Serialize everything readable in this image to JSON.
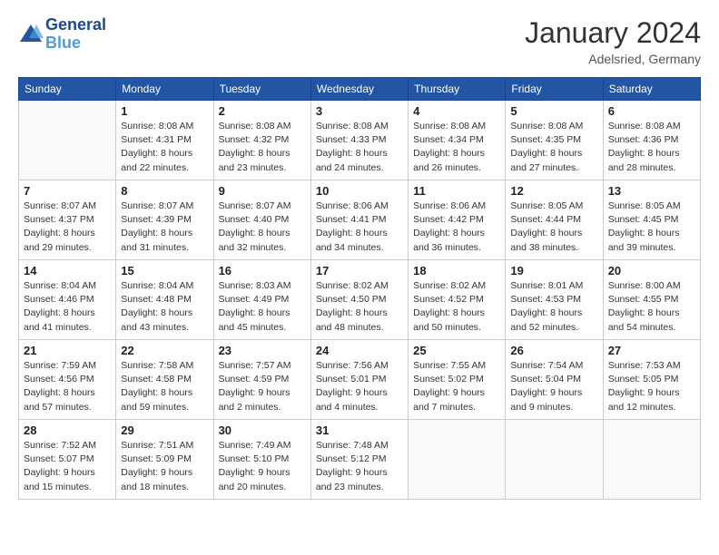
{
  "header": {
    "logo_line1": "General",
    "logo_line2": "Blue",
    "month": "January 2024",
    "location": "Adelsried, Germany"
  },
  "days_of_week": [
    "Sunday",
    "Monday",
    "Tuesday",
    "Wednesday",
    "Thursday",
    "Friday",
    "Saturday"
  ],
  "weeks": [
    [
      {
        "day": "",
        "info": ""
      },
      {
        "day": "1",
        "info": "Sunrise: 8:08 AM\nSunset: 4:31 PM\nDaylight: 8 hours\nand 22 minutes."
      },
      {
        "day": "2",
        "info": "Sunrise: 8:08 AM\nSunset: 4:32 PM\nDaylight: 8 hours\nand 23 minutes."
      },
      {
        "day": "3",
        "info": "Sunrise: 8:08 AM\nSunset: 4:33 PM\nDaylight: 8 hours\nand 24 minutes."
      },
      {
        "day": "4",
        "info": "Sunrise: 8:08 AM\nSunset: 4:34 PM\nDaylight: 8 hours\nand 26 minutes."
      },
      {
        "day": "5",
        "info": "Sunrise: 8:08 AM\nSunset: 4:35 PM\nDaylight: 8 hours\nand 27 minutes."
      },
      {
        "day": "6",
        "info": "Sunrise: 8:08 AM\nSunset: 4:36 PM\nDaylight: 8 hours\nand 28 minutes."
      }
    ],
    [
      {
        "day": "7",
        "info": "Sunrise: 8:07 AM\nSunset: 4:37 PM\nDaylight: 8 hours\nand 29 minutes."
      },
      {
        "day": "8",
        "info": "Sunrise: 8:07 AM\nSunset: 4:39 PM\nDaylight: 8 hours\nand 31 minutes."
      },
      {
        "day": "9",
        "info": "Sunrise: 8:07 AM\nSunset: 4:40 PM\nDaylight: 8 hours\nand 32 minutes."
      },
      {
        "day": "10",
        "info": "Sunrise: 8:06 AM\nSunset: 4:41 PM\nDaylight: 8 hours\nand 34 minutes."
      },
      {
        "day": "11",
        "info": "Sunrise: 8:06 AM\nSunset: 4:42 PM\nDaylight: 8 hours\nand 36 minutes."
      },
      {
        "day": "12",
        "info": "Sunrise: 8:05 AM\nSunset: 4:44 PM\nDaylight: 8 hours\nand 38 minutes."
      },
      {
        "day": "13",
        "info": "Sunrise: 8:05 AM\nSunset: 4:45 PM\nDaylight: 8 hours\nand 39 minutes."
      }
    ],
    [
      {
        "day": "14",
        "info": "Sunrise: 8:04 AM\nSunset: 4:46 PM\nDaylight: 8 hours\nand 41 minutes."
      },
      {
        "day": "15",
        "info": "Sunrise: 8:04 AM\nSunset: 4:48 PM\nDaylight: 8 hours\nand 43 minutes."
      },
      {
        "day": "16",
        "info": "Sunrise: 8:03 AM\nSunset: 4:49 PM\nDaylight: 8 hours\nand 45 minutes."
      },
      {
        "day": "17",
        "info": "Sunrise: 8:02 AM\nSunset: 4:50 PM\nDaylight: 8 hours\nand 48 minutes."
      },
      {
        "day": "18",
        "info": "Sunrise: 8:02 AM\nSunset: 4:52 PM\nDaylight: 8 hours\nand 50 minutes."
      },
      {
        "day": "19",
        "info": "Sunrise: 8:01 AM\nSunset: 4:53 PM\nDaylight: 8 hours\nand 52 minutes."
      },
      {
        "day": "20",
        "info": "Sunrise: 8:00 AM\nSunset: 4:55 PM\nDaylight: 8 hours\nand 54 minutes."
      }
    ],
    [
      {
        "day": "21",
        "info": "Sunrise: 7:59 AM\nSunset: 4:56 PM\nDaylight: 8 hours\nand 57 minutes."
      },
      {
        "day": "22",
        "info": "Sunrise: 7:58 AM\nSunset: 4:58 PM\nDaylight: 8 hours\nand 59 minutes."
      },
      {
        "day": "23",
        "info": "Sunrise: 7:57 AM\nSunset: 4:59 PM\nDaylight: 9 hours\nand 2 minutes."
      },
      {
        "day": "24",
        "info": "Sunrise: 7:56 AM\nSunset: 5:01 PM\nDaylight: 9 hours\nand 4 minutes."
      },
      {
        "day": "25",
        "info": "Sunrise: 7:55 AM\nSunset: 5:02 PM\nDaylight: 9 hours\nand 7 minutes."
      },
      {
        "day": "26",
        "info": "Sunrise: 7:54 AM\nSunset: 5:04 PM\nDaylight: 9 hours\nand 9 minutes."
      },
      {
        "day": "27",
        "info": "Sunrise: 7:53 AM\nSunset: 5:05 PM\nDaylight: 9 hours\nand 12 minutes."
      }
    ],
    [
      {
        "day": "28",
        "info": "Sunrise: 7:52 AM\nSunset: 5:07 PM\nDaylight: 9 hours\nand 15 minutes."
      },
      {
        "day": "29",
        "info": "Sunrise: 7:51 AM\nSunset: 5:09 PM\nDaylight: 9 hours\nand 18 minutes."
      },
      {
        "day": "30",
        "info": "Sunrise: 7:49 AM\nSunset: 5:10 PM\nDaylight: 9 hours\nand 20 minutes."
      },
      {
        "day": "31",
        "info": "Sunrise: 7:48 AM\nSunset: 5:12 PM\nDaylight: 9 hours\nand 23 minutes."
      },
      {
        "day": "",
        "info": ""
      },
      {
        "day": "",
        "info": ""
      },
      {
        "day": "",
        "info": ""
      }
    ]
  ]
}
